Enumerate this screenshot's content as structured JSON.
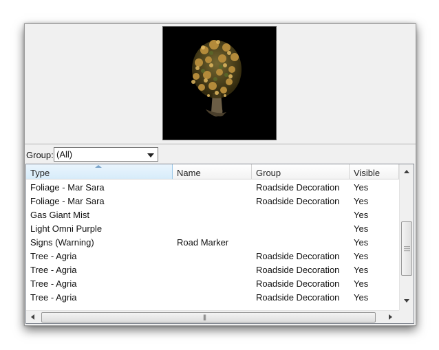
{
  "group_filter": {
    "label": "Group:",
    "selected": "(All)"
  },
  "preview": {
    "image": "tree-preview"
  },
  "grid": {
    "columns": [
      "Type",
      "Name",
      "Group",
      "Visible"
    ],
    "sorted_column": "Type",
    "rows": [
      {
        "type": "Foliage - Mar Sara",
        "name": "",
        "group": "Roadside Decoration",
        "visible": "Yes"
      },
      {
        "type": "Foliage - Mar Sara",
        "name": "",
        "group": "Roadside Decoration",
        "visible": "Yes"
      },
      {
        "type": "Gas Giant Mist",
        "name": "",
        "group": "",
        "visible": "Yes"
      },
      {
        "type": "Light Omni Purple",
        "name": "",
        "group": "",
        "visible": "Yes"
      },
      {
        "type": "Signs (Warning)",
        "name": "Road Marker",
        "group": "",
        "visible": "Yes"
      },
      {
        "type": "Tree - Agria",
        "name": "",
        "group": "Roadside Decoration",
        "visible": "Yes"
      },
      {
        "type": "Tree - Agria",
        "name": "",
        "group": "Roadside Decoration",
        "visible": "Yes"
      },
      {
        "type": "Tree - Agria",
        "name": "",
        "group": "Roadside Decoration",
        "visible": "Yes"
      },
      {
        "type": "Tree - Agria",
        "name": "",
        "group": "Roadside Decoration",
        "visible": "Yes"
      },
      {
        "type": "",
        "name": "",
        "group": "",
        "visible": ""
      }
    ]
  }
}
